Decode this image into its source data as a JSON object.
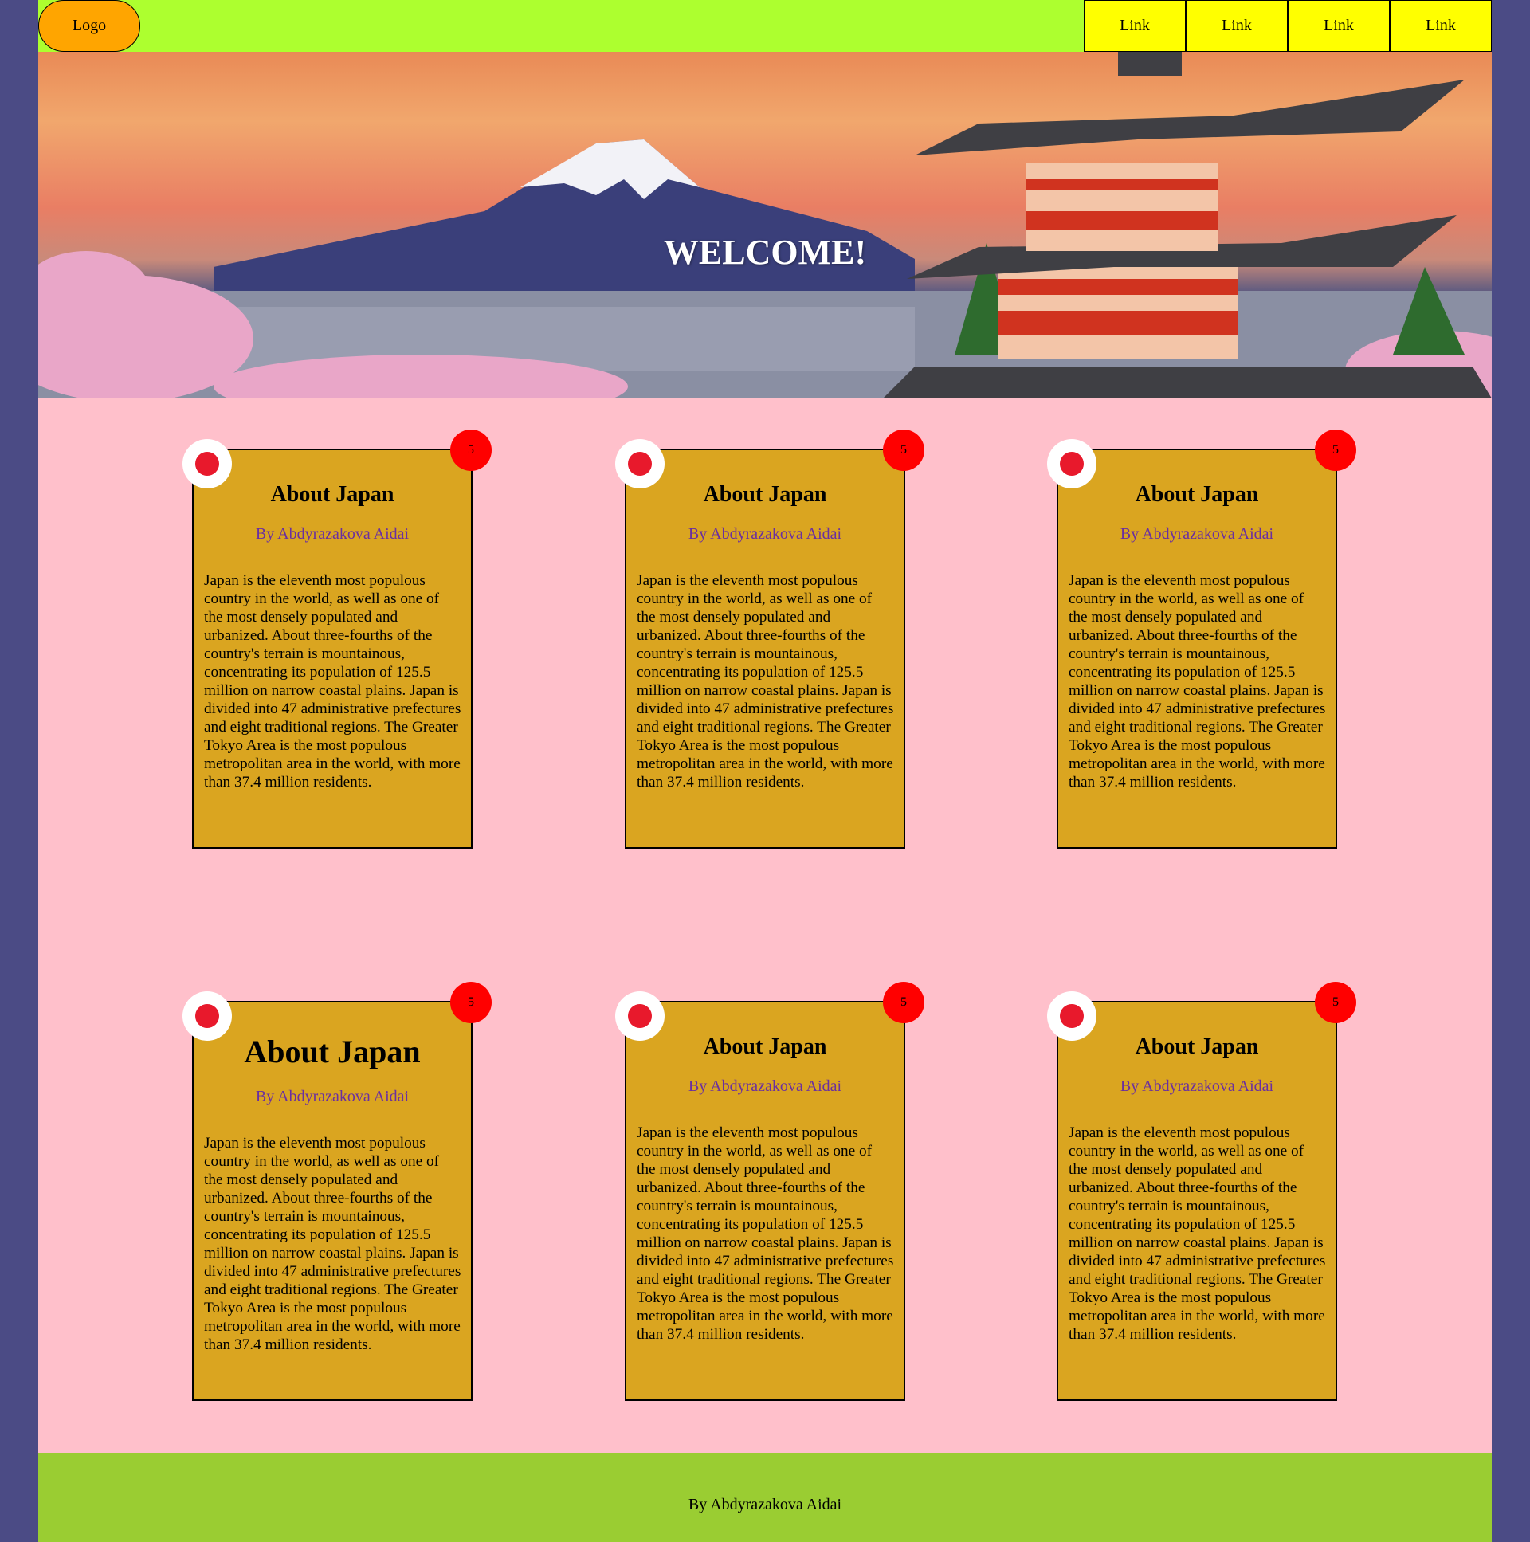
{
  "header": {
    "logo_label": "Logo",
    "nav_links": [
      "Link",
      "Link",
      "Link",
      "Link"
    ]
  },
  "hero": {
    "title": "WELCOME!"
  },
  "cards": [
    {
      "badge": "5",
      "title": "About Japan",
      "author": "By Abdyrazakova Aidai",
      "text": "Japan is the eleventh most populous country in the world, as well as one of the most densely populated and urbanized. About three-fourths of the country's terrain is mountainous, concentrating its population of 125.5 million on narrow coastal plains. Japan is divided into 47 administrative prefectures and eight traditional regions. The Greater Tokyo Area is the most populous metropolitan area in the world, with more than 37.4 million residents."
    },
    {
      "badge": "5",
      "title": "About Japan",
      "author": "By Abdyrazakova Aidai",
      "text": "Japan is the eleventh most populous country in the world, as well as one of the most densely populated and urbanized. About three-fourths of the country's terrain is mountainous, concentrating its population of 125.5 million on narrow coastal plains. Japan is divided into 47 administrative prefectures and eight traditional regions. The Greater Tokyo Area is the most populous metropolitan area in the world, with more than 37.4 million residents."
    },
    {
      "badge": "5",
      "title": "About Japan",
      "author": "By Abdyrazakova Aidai",
      "text": "Japan is the eleventh most populous country in the world, as well as one of the most densely populated and urbanized. About three-fourths of the country's terrain is mountainous, concentrating its population of 125.5 million on narrow coastal plains. Japan is divided into 47 administrative prefectures and eight traditional regions. The Greater Tokyo Area is the most populous metropolitan area in the world, with more than 37.4 million residents."
    },
    {
      "badge": "5",
      "title": "About Japan",
      "author": "By Abdyrazakova Aidai",
      "text": "Japan is the eleventh most populous country in the world, as well as one of the most densely populated and urbanized. About three-fourths of the country's terrain is mountainous, concentrating its population of 125.5 million on narrow coastal plains. Japan is divided into 47 administrative prefectures and eight traditional regions. The Greater Tokyo Area is the most populous metropolitan area in the world, with more than 37.4 million residents."
    },
    {
      "badge": "5",
      "title": "About Japan",
      "author": "By Abdyrazakova Aidai",
      "text": "Japan is the eleventh most populous country in the world, as well as one of the most densely populated and urbanized. About three-fourths of the country's terrain is mountainous, concentrating its population of 125.5 million on narrow coastal plains. Japan is divided into 47 administrative prefectures and eight traditional regions. The Greater Tokyo Area is the most populous metropolitan area in the world, with more than 37.4 million residents."
    },
    {
      "badge": "5",
      "title": "About Japan",
      "author": "By Abdyrazakova Aidai",
      "text": "Japan is the eleventh most populous country in the world, as well as one of the most densely populated and urbanized. About three-fourths of the country's terrain is mountainous, concentrating its population of 125.5 million on narrow coastal plains. Japan is divided into 47 administrative prefectures and eight traditional regions. The Greater Tokyo Area is the most populous metropolitan area in the world, with more than 37.4 million residents."
    }
  ],
  "footer": {
    "text": "By Abdyrazakova Aidai"
  },
  "colors": {
    "outer_background": "#4b4b85",
    "page_background": "#ffc0cb",
    "header_background": "#adff2f",
    "logo_background": "#ffa500",
    "nav_link_background": "#ffff00",
    "card_background": "#daa520",
    "badge_background": "#ff0000",
    "flag_dot": "#e8192c",
    "author_text": "#6a2fa0",
    "footer_background": "#9acd32"
  }
}
